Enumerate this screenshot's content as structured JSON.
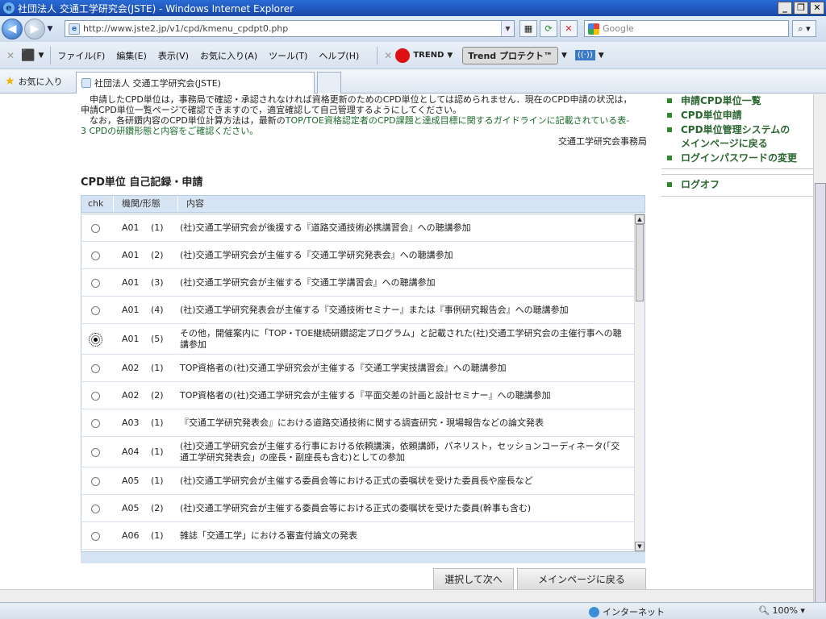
{
  "window": {
    "title": "社団法人 交通工学研究会(JSTE) - Windows Internet Explorer"
  },
  "address": {
    "url": "http://www.jste2.jp/v1/cpd/kmenu_cpdpt0.php"
  },
  "search": {
    "placeholder": "Google"
  },
  "menu": {
    "items": [
      "ファイル(F)",
      "編集(E)",
      "表示(V)",
      "お気に入り(A)",
      "ツール(T)",
      "ヘルプ(H)"
    ],
    "trend_label": "TREND",
    "protect_label": "Trend プロテクト™"
  },
  "favorites": {
    "label": "お気に入り",
    "tab_title": "社団法人 交通工学研究会(JSTE)"
  },
  "intro": {
    "line1": "　申請したCPD単位は，事務局で確認・承認されなければ資格更新のためのCPD単位としては認められません．現在のCPD申請の状況は，",
    "line2": "申請CPD単位一覧ページで確認できますので，適宜確認して自己管理するようにしてください。",
    "line3a": "　なお，各研鑽内容のCPD単位計算方法は，最新の",
    "line3link": "TOP/TOE資格認定者のCPD課題と達成目標に関するガイドラインに記載されている表-",
    "line4": "3 CPDの研鑽形態と内容をご確認ください。",
    "office": "交通工学研究会事務局"
  },
  "section": {
    "title": "CPD単位 自己記録・申請"
  },
  "table": {
    "headers": [
      "chk",
      "機関/形態",
      "内容"
    ],
    "rows": [
      {
        "code": "A01",
        "num": "(1)",
        "desc": "(社)交通工学研究会が後援する『道路交通技術必携講習会』への聴講参加",
        "selected": false,
        "tall": false
      },
      {
        "code": "A01",
        "num": "(2)",
        "desc": "(社)交通工学研究会が主催する『交通工学研究発表会』への聴講参加",
        "selected": false,
        "tall": false
      },
      {
        "code": "A01",
        "num": "(3)",
        "desc": "(社)交通工学研究会が主催する『交通工学講習会』への聴講参加",
        "selected": false,
        "tall": false
      },
      {
        "code": "A01",
        "num": "(4)",
        "desc": "(社)交通工学研究発表会が主催する『交通技術セミナー』または『事例研究報告会』への聴講参加",
        "selected": false,
        "tall": false
      },
      {
        "code": "A01",
        "num": "(5)",
        "desc": "その他，開催案内に「TOP・TOE継続研鑽認定プログラム」と記載された(社)交通工学研究会の主催行事への聴講参加",
        "selected": true,
        "tall": true
      },
      {
        "code": "A02",
        "num": "(1)",
        "desc": "TOP資格者の(社)交通工学研究会が主催する『交通工学実技講習会』への聴講参加",
        "selected": false,
        "tall": false
      },
      {
        "code": "A02",
        "num": "(2)",
        "desc": "TOP資格者の(社)交通工学研究会が主催する『平面交差の計画と設計セミナー』への聴講参加",
        "selected": false,
        "tall": false
      },
      {
        "code": "A03",
        "num": "(1)",
        "desc": "『交通工学研究発表会』における道路交通技術に関する調査研究・現場報告などの論文発表",
        "selected": false,
        "tall": false
      },
      {
        "code": "A04",
        "num": "(1)",
        "desc": "(社)交通工学研究会が主催する行事における依頼講演，依頼講師，パネリスト，セッションコーディネータ(「交通工学研究発表会」の座長・副座長も含む)としての参加",
        "selected": false,
        "tall": true
      },
      {
        "code": "A05",
        "num": "(1)",
        "desc": "(社)交通工学研究会が主催する委員会等における正式の委嘱状を受けた委員長や座長など",
        "selected": false,
        "tall": false
      },
      {
        "code": "A05",
        "num": "(2)",
        "desc": "(社)交通工学研究会が主催する委員会等における正式の委嘱状を受けた委員(幹事も含む)",
        "selected": false,
        "tall": false
      },
      {
        "code": "A06",
        "num": "(1)",
        "desc": "雑誌「交通工学」における審査付論文の発表",
        "selected": false,
        "tall": false
      }
    ]
  },
  "buttons": {
    "next": "選択して次へ",
    "back": "メインページに戻る"
  },
  "sidenav": {
    "items": [
      "申請CPD単位一覧",
      "CPD単位申請",
      "CPD単位管理システムの\nメインページに戻る",
      "ログインパスワードの変更"
    ],
    "logoff": "ログオフ"
  },
  "status": {
    "zone": "インターネット",
    "zoom": "100%"
  }
}
